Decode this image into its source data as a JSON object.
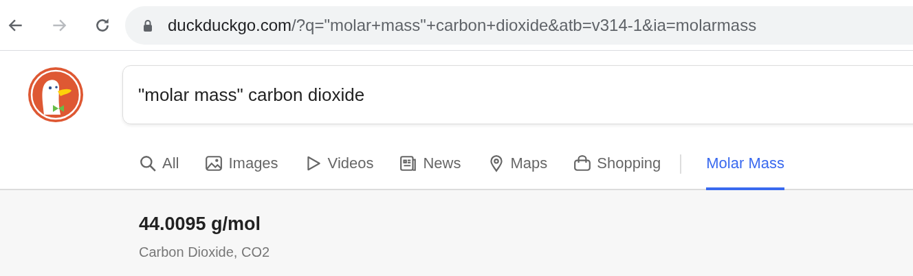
{
  "browser": {
    "url": {
      "host": "duckduckgo.com",
      "path": "/?q=\"molar+mass\"+carbon+dioxide&atb=v314-1&ia=molarmass"
    },
    "secure": true,
    "forward_disabled": true
  },
  "search": {
    "value": "\"molar mass\" carbon dioxide"
  },
  "tabs": [
    {
      "label": "All",
      "kind": "all",
      "selected": false
    },
    {
      "label": "Images",
      "kind": "images",
      "selected": false
    },
    {
      "label": "Videos",
      "kind": "videos",
      "selected": false
    },
    {
      "label": "News",
      "kind": "news",
      "selected": false
    },
    {
      "label": "Maps",
      "kind": "maps",
      "selected": false
    },
    {
      "label": "Shopping",
      "kind": "shopping",
      "selected": false
    },
    {
      "label": "Molar Mass",
      "kind": "instant",
      "selected": true
    }
  ],
  "result": {
    "value": "44.0095 g/mol",
    "subtitle": "Carbon Dioxide, CO2"
  }
}
